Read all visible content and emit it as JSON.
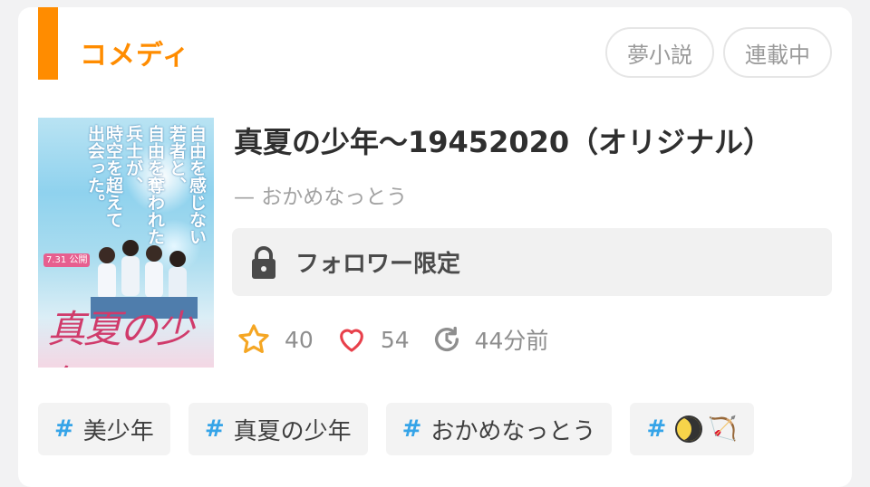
{
  "genre": "コメディ",
  "pills": [
    "夢小説",
    "連載中"
  ],
  "cover": {
    "vertical_lines": [
      "自由を感じない",
      "若者と、",
      "自由を奪われた",
      "兵士が、",
      "時空を超えて",
      "出会った。"
    ],
    "date_text": "7.31 公開",
    "logo_text": "真夏の少年"
  },
  "title": "真夏の少年〜19452020（オリジナル）",
  "author": "— おかめなっとう",
  "restricted_label": "フォロワー限定",
  "stats": {
    "stars": "40",
    "likes": "54",
    "updated": "44分前"
  },
  "tags": [
    {
      "hash": "#",
      "label": "美少年"
    },
    {
      "hash": "#",
      "label": "真夏の少年"
    },
    {
      "hash": "#",
      "label": "おかめなっとう"
    },
    {
      "hash": "#",
      "label": "🏹"
    }
  ],
  "colors": {
    "accent": "#ff8c00",
    "hash": "#35a4e8",
    "star": "#f5a623",
    "heart": "#e8404b"
  }
}
